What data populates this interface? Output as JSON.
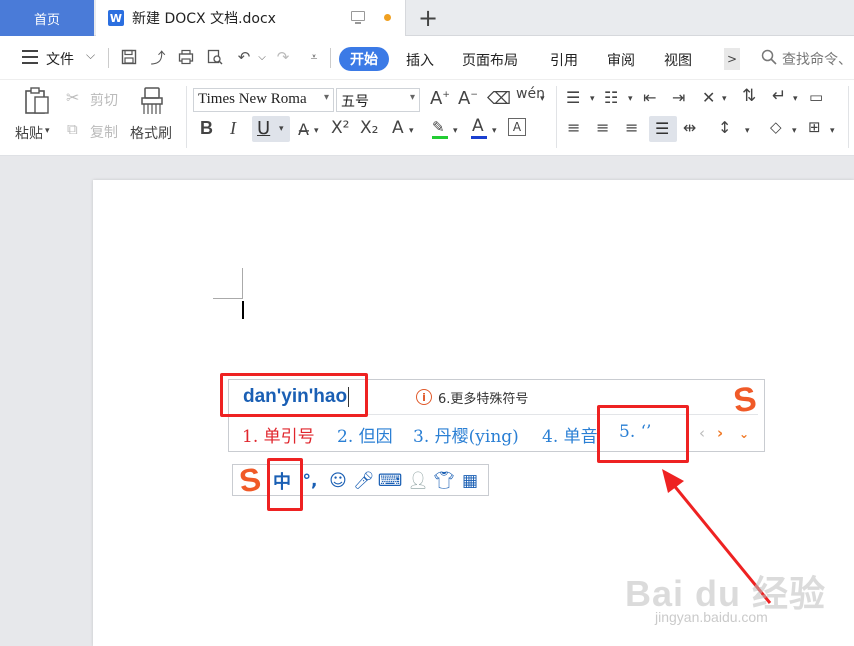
{
  "titlebar": {
    "home_tab": "首页",
    "doc_tab": "新建 DOCX 文档.docx",
    "doc_icon_letter": "W",
    "add_tab_glyph": "+"
  },
  "menubar": {
    "file_label": "文件",
    "tabs": [
      "开始",
      "插入",
      "页面布局",
      "引用",
      "审阅",
      "视图"
    ],
    "more_glyph": ">",
    "search_placeholder": "查找命令、"
  },
  "ribbon": {
    "paste_label": "粘贴",
    "cut_label": "剪切",
    "copy_label": "复制",
    "format_painter_label": "格式刷",
    "font_name": "Times New Roma",
    "font_size": "五号",
    "bold_glyph": "B",
    "italic_glyph": "I",
    "underline_glyph": "U",
    "superscript_glyph": "X²",
    "subscript_glyph": "X₂",
    "phonetic_glyph": "wén"
  },
  "ime": {
    "pinyin": "dan'yin'hao",
    "more_symbols": "6.更多特殊符号",
    "candidates": [
      {
        "index": "1.",
        "text": "单引号"
      },
      {
        "index": "2.",
        "text": "但因"
      },
      {
        "index": "3.",
        "text": "丹樱(ying)"
      },
      {
        "index": "4.",
        "text": "单音"
      },
      {
        "index": "5.",
        "text": "‘’"
      }
    ],
    "logo_glyph": "S",
    "status_mode": "中",
    "status_punct": "°,"
  },
  "colors": {
    "accent_blue": "#3b7ae6",
    "ime_blue": "#1a5fb4",
    "annotation_red": "#ee2222",
    "sogou_orange": "#f05a28"
  },
  "watermark": {
    "main": "Bai du 经验",
    "sub": "jingyan.baidu.com"
  }
}
